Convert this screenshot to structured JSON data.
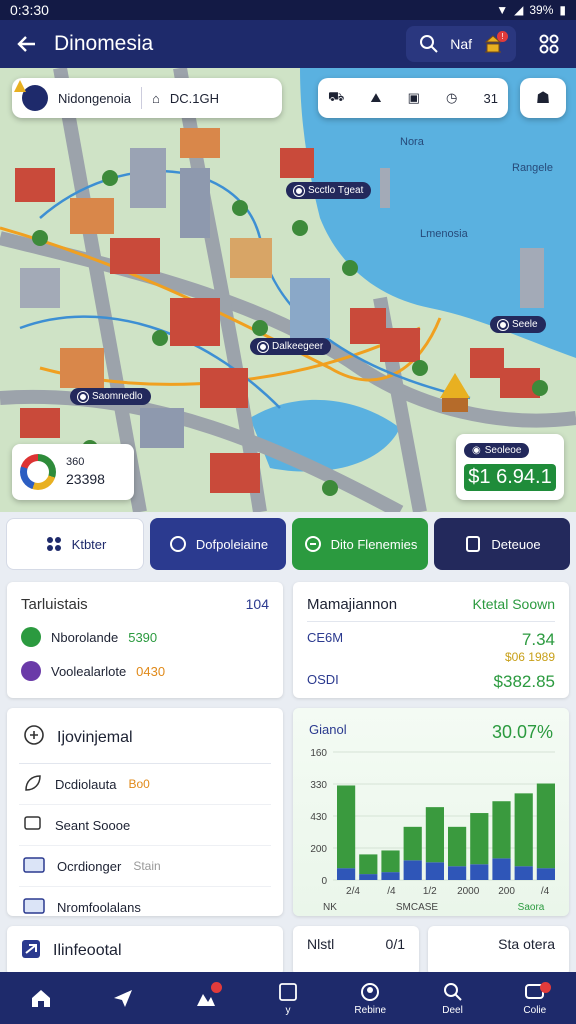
{
  "status": {
    "time": "0:3:30",
    "battery": "39%"
  },
  "app": {
    "title": "Dinomesia",
    "action_label": "Naf"
  },
  "map": {
    "location_chip": {
      "name": "Nidongenoia",
      "code": "DC.1GH"
    },
    "tool_label": "31",
    "place_labels": [
      "Nora",
      "Rangele",
      "Lmenosia"
    ],
    "pins": [
      {
        "label": "Scctlo Tgeat"
      },
      {
        "label": "Dalkeegeer"
      },
      {
        "label": "Seele"
      },
      {
        "label": "Saomnedlo"
      }
    ],
    "score": {
      "top": "360",
      "value": "23398"
    },
    "price": {
      "tag": "Seoleoe",
      "value": "$1 6.94.1"
    }
  },
  "tabs": [
    {
      "label": "Ktbter"
    },
    {
      "label": "Dofpoleiaine"
    },
    {
      "label": "Dito Flenemies"
    },
    {
      "label": "Deteuoe"
    }
  ],
  "tour": {
    "title": "Tarluistais",
    "count": "104",
    "rows": [
      {
        "label": "Nborolande",
        "value": "5390",
        "color": "#2b9a3f"
      },
      {
        "label": "Voolealarlote",
        "value": "0430",
        "color": "#6a3aa8"
      }
    ]
  },
  "mgmt": {
    "title": "Mamajiannon",
    "tag": "Ktetal Soown",
    "rows": [
      {
        "label": "CE6M",
        "main": "7.34",
        "sub": "$06 1989"
      },
      {
        "label": "OSDI",
        "main": "$382.85",
        "sub": ""
      }
    ]
  },
  "list": {
    "title": "Ijovinjemal",
    "items": [
      {
        "label": "Dcdiolauta",
        "value": "Bo0"
      },
      {
        "label": "Seant Soooe",
        "value": ""
      },
      {
        "label": "Ocrdionger",
        "value": "Stain"
      },
      {
        "label": "Nromfoolalans",
        "value": ""
      }
    ]
  },
  "chart_data": {
    "type": "bar",
    "title": "Gianol",
    "headline": "30.07%",
    "yticks": [
      "160",
      "330",
      "430",
      "200",
      "0"
    ],
    "xticks": [
      "2/4",
      "/4",
      "1/2",
      "2000",
      "200",
      "/4"
    ],
    "xfoot": [
      "NK",
      "SMCASE",
      "Saora"
    ],
    "categories": [
      "c1",
      "c2",
      "c3",
      "c4",
      "c5",
      "c6",
      "c7",
      "c8",
      "c9",
      "c10"
    ],
    "series": [
      {
        "values": [
          12,
          6,
          8,
          20,
          18,
          14,
          16,
          22,
          14,
          12
        ]
      },
      {
        "values": [
          84,
          20,
          22,
          34,
          56,
          40,
          52,
          58,
          74,
          86
        ]
      }
    ],
    "ylim": [
      0,
      130
    ],
    "colors": [
      "#2f56b8",
      "#3a9a3e"
    ]
  },
  "bottom": {
    "left_title": "Ilinfeootal",
    "mid_label": "Nlstl",
    "mid_value": "0/1",
    "right_label": "Sta otera"
  },
  "nav": [
    {
      "label": "",
      "icon": "home-icon"
    },
    {
      "label": "",
      "icon": "navigate-icon"
    },
    {
      "label": "",
      "icon": "tour-icon"
    },
    {
      "label": "y",
      "icon": "document-icon"
    },
    {
      "label": "Rebine",
      "icon": "profile-icon"
    },
    {
      "label": "Deel",
      "icon": "search-icon"
    },
    {
      "label": "Colie",
      "icon": "chat-icon"
    }
  ]
}
